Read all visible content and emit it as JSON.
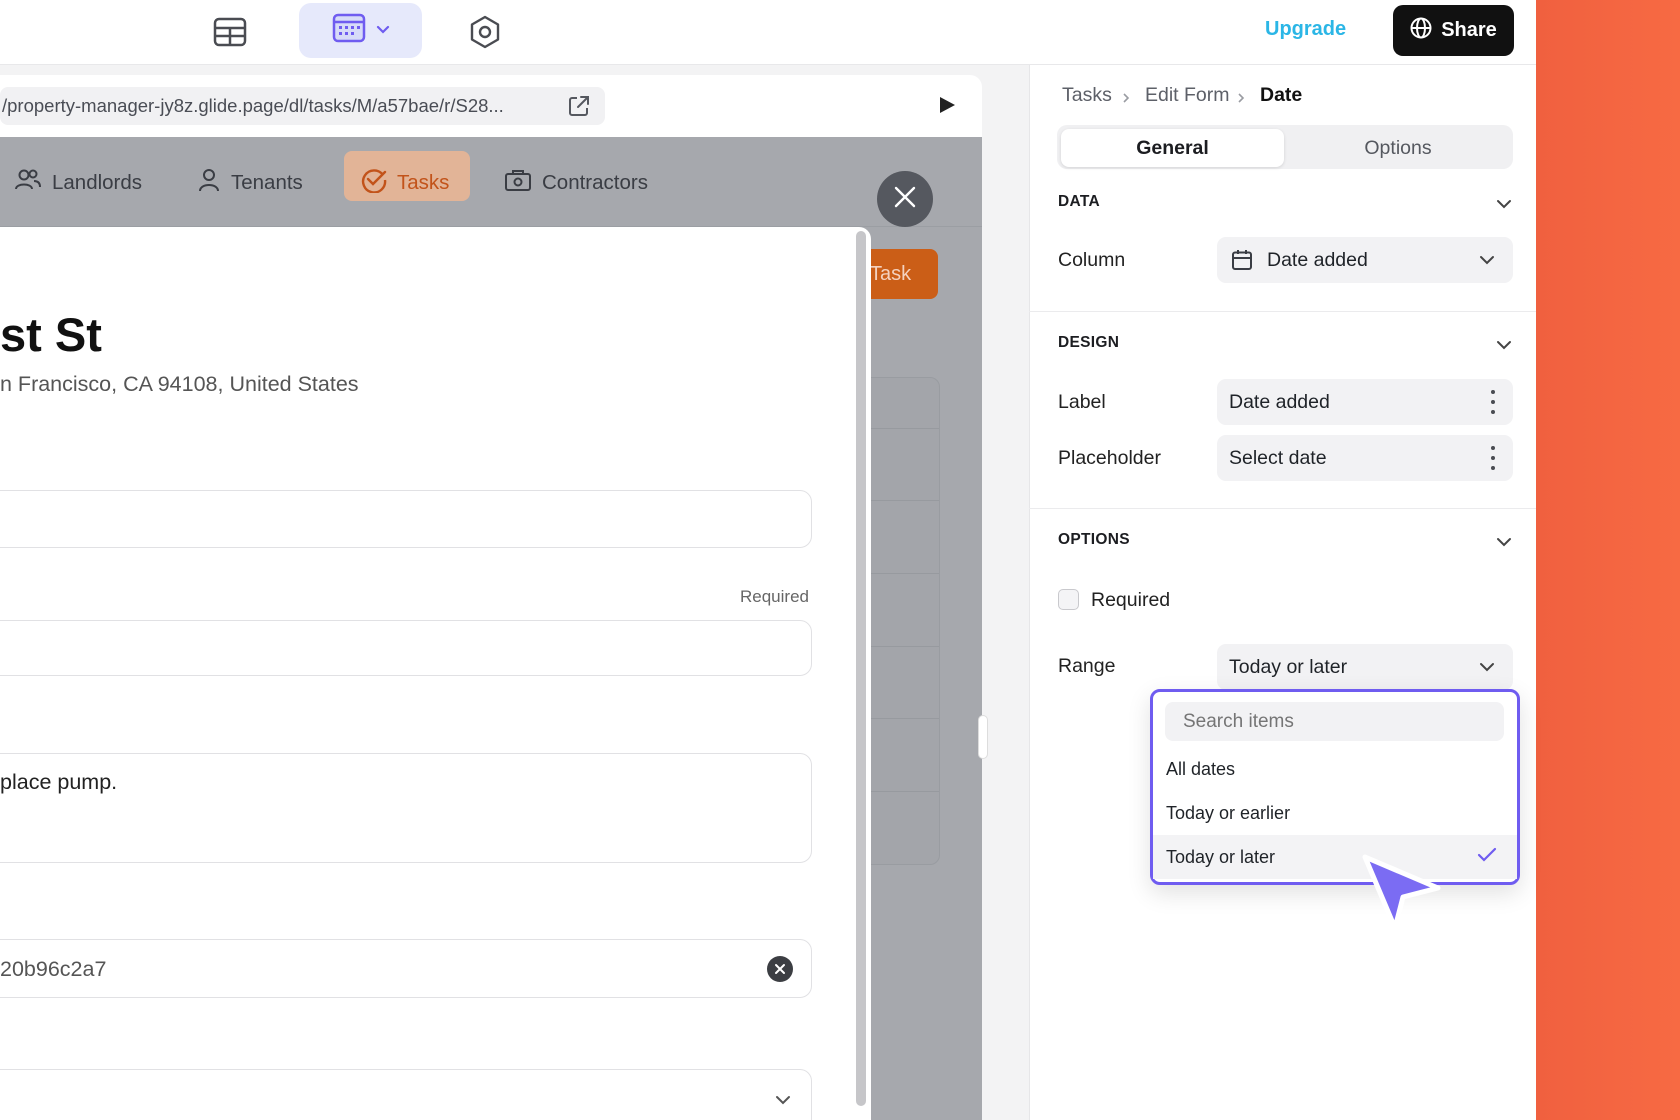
{
  "topbar": {
    "icons": [
      "table-icon",
      "calendar-view-icon",
      "settings-hex-icon"
    ],
    "upgrade": "Upgrade",
    "share": "Share"
  },
  "preview": {
    "url": "/property-manager-jy8z.glide.page/dl/tasks/M/a57bae/r/S28...",
    "tabs": [
      {
        "label": "Landlords",
        "icon": "people-icon"
      },
      {
        "label": "Tenants",
        "icon": "person-icon"
      },
      {
        "label": "Tasks",
        "icon": "check-circle-icon",
        "active": true
      },
      {
        "label": "Contractors",
        "icon": "toolbox-icon"
      }
    ],
    "background_button": "Task",
    "sheet": {
      "title": "st St",
      "subtitle": "n Francisco, CA 94108, United States",
      "required_label": "Required",
      "notes_value": "place pump.",
      "id_value": "20b96c2a7"
    }
  },
  "panel": {
    "breadcrumb": [
      "Tasks",
      "Edit Form",
      "Date"
    ],
    "tabs": {
      "general": "General",
      "options": "Options"
    },
    "data_section": {
      "heading": "DATA",
      "column_label": "Column",
      "column_value": "Date added"
    },
    "design_section": {
      "heading": "DESIGN",
      "label_label": "Label",
      "label_value": "Date added",
      "placeholder_label": "Placeholder",
      "placeholder_value": "Select date"
    },
    "options_section": {
      "heading": "OPTIONS",
      "required_label": "Required",
      "required_checked": false,
      "range_label": "Range",
      "range_value": "Today or later"
    },
    "dropdown": {
      "search_placeholder": "Search items",
      "items": [
        "All dates",
        "Today or earlier",
        "Today or later"
      ],
      "selected": "Today or later"
    }
  },
  "colors": {
    "accent_purple": "#6f5cf0",
    "share_bg": "#111111",
    "upgrade": "#2bb6e6",
    "task_orange": "#cb5e17",
    "side_orange": "#f76a43"
  }
}
